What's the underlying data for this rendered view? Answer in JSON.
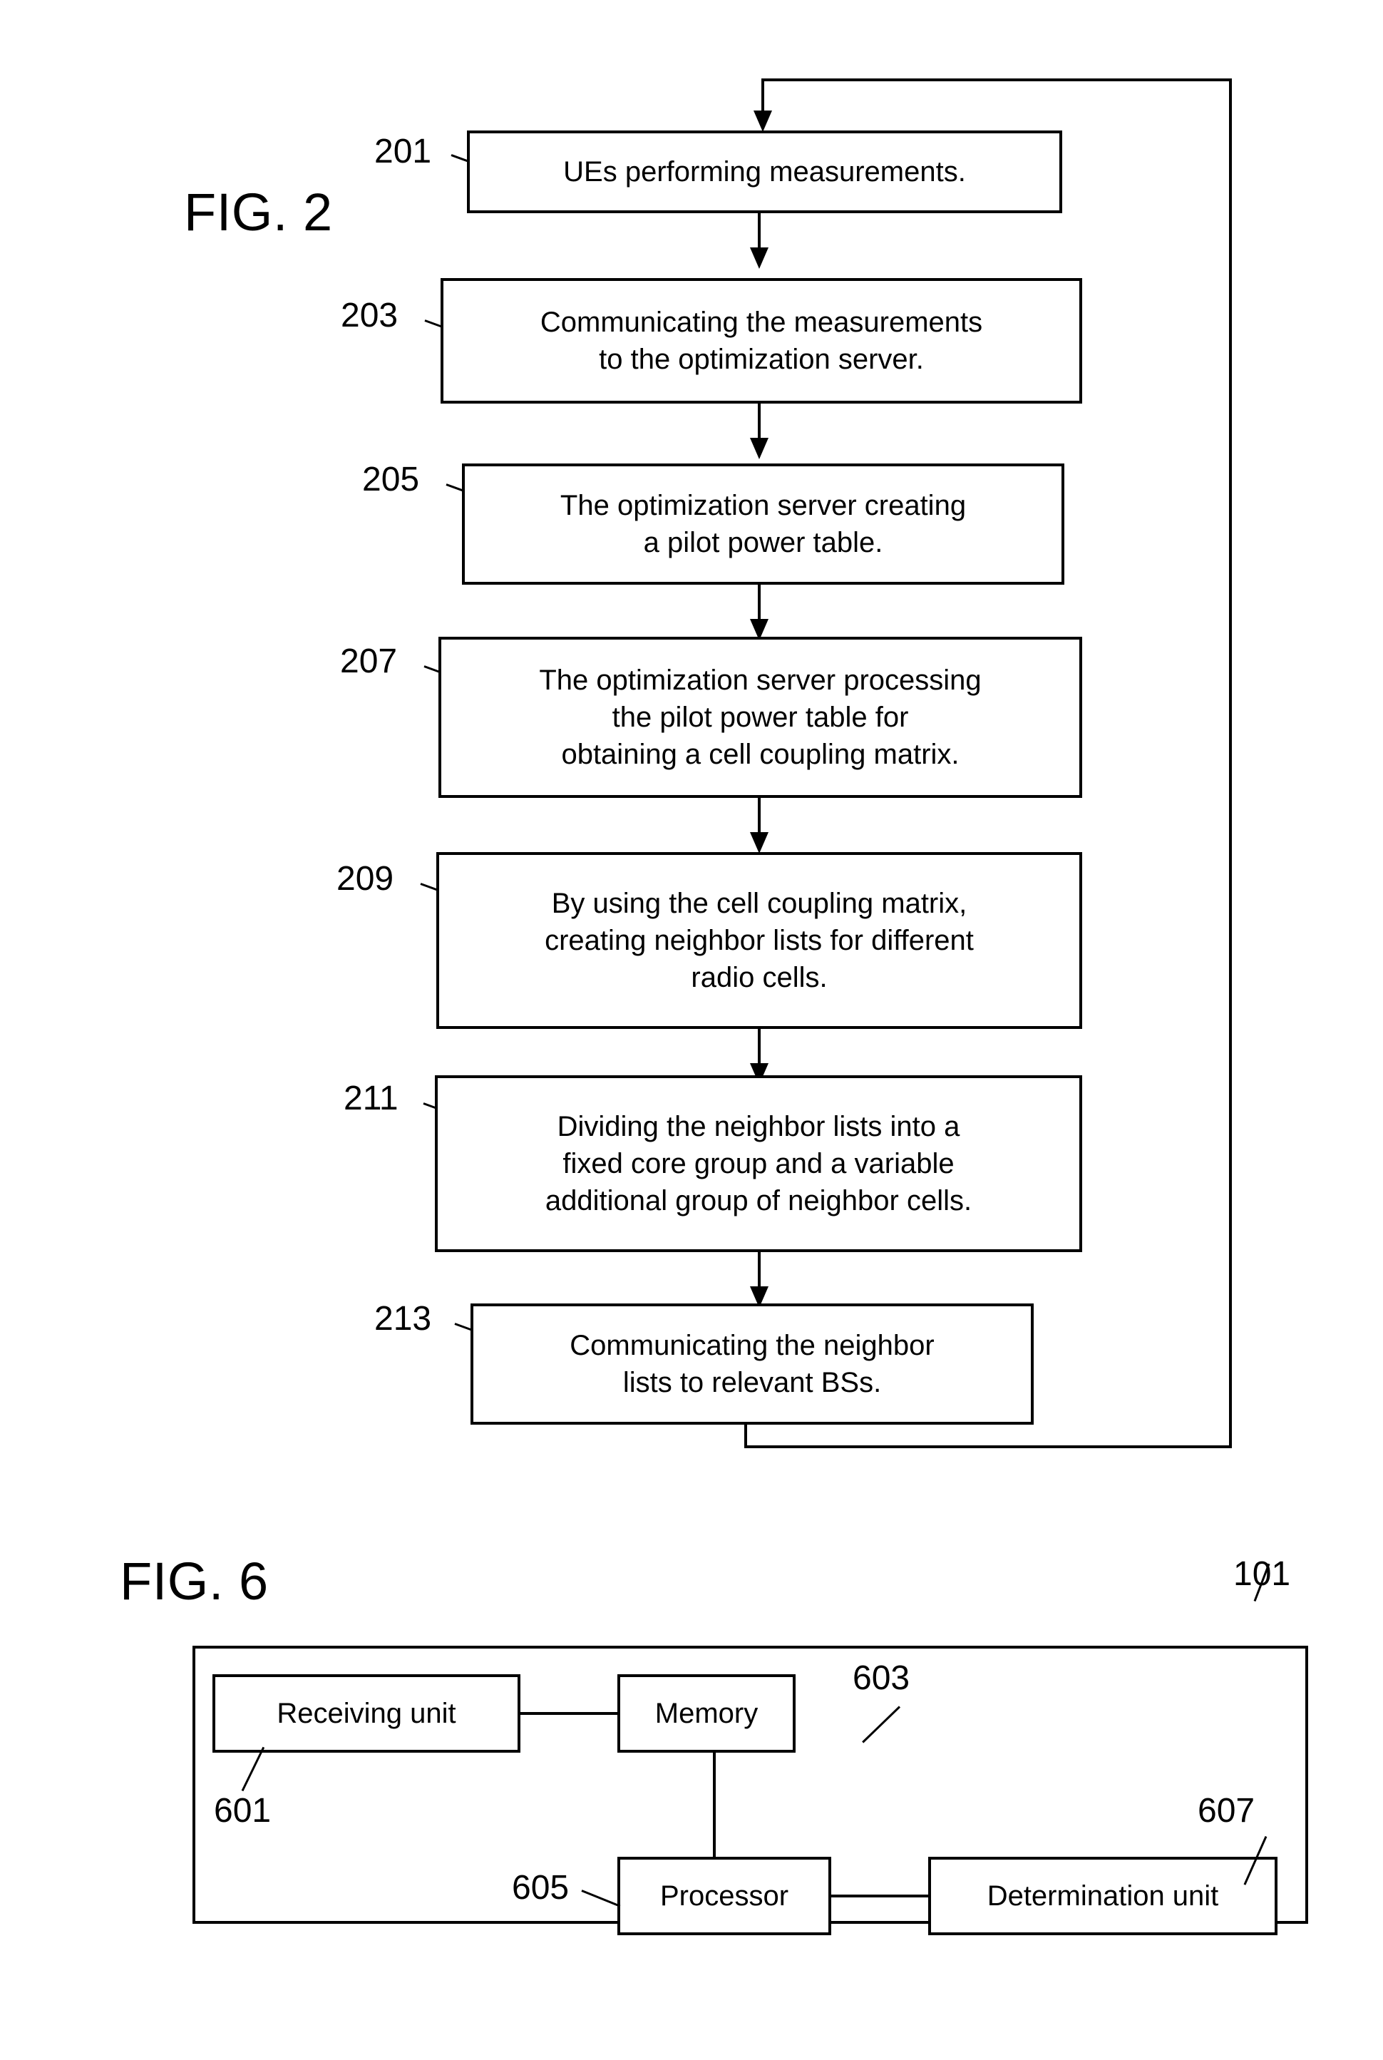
{
  "figures": [
    {
      "id": "fig2",
      "label": "FIG. 2",
      "type": "flowchart",
      "steps": [
        {
          "ref": "201",
          "text": "UEs performing measurements."
        },
        {
          "ref": "203",
          "text": "Communicating the measurements\nto the optimization server."
        },
        {
          "ref": "205",
          "text": "The optimization server creating\na pilot power table."
        },
        {
          "ref": "207",
          "text": "The optimization server processing\nthe pilot power table for\nobtaining a cell coupling matrix."
        },
        {
          "ref": "209",
          "text": "By using the cell coupling matrix,\ncreating neighbor lists for different\nradio cells."
        },
        {
          "ref": "211",
          "text": "Dividing the neighbor lists into a\nfixed core group and a variable\nadditional group of neighbor cells."
        },
        {
          "ref": "213",
          "text": "Communicating the neighbor\nlists to relevant BSs."
        }
      ],
      "feedback_loop": "from step 213 back to step 201"
    },
    {
      "id": "fig6",
      "label": "FIG. 6",
      "type": "block-diagram",
      "container_ref": "101",
      "blocks": [
        {
          "ref": "601",
          "text": "Receiving unit"
        },
        {
          "ref": "603",
          "text": "Memory"
        },
        {
          "ref": "605",
          "text": "Processor"
        },
        {
          "ref": "607",
          "text": "Determination unit"
        }
      ]
    }
  ],
  "colors": {
    "ink": "#000000",
    "paper": "#ffffff"
  }
}
